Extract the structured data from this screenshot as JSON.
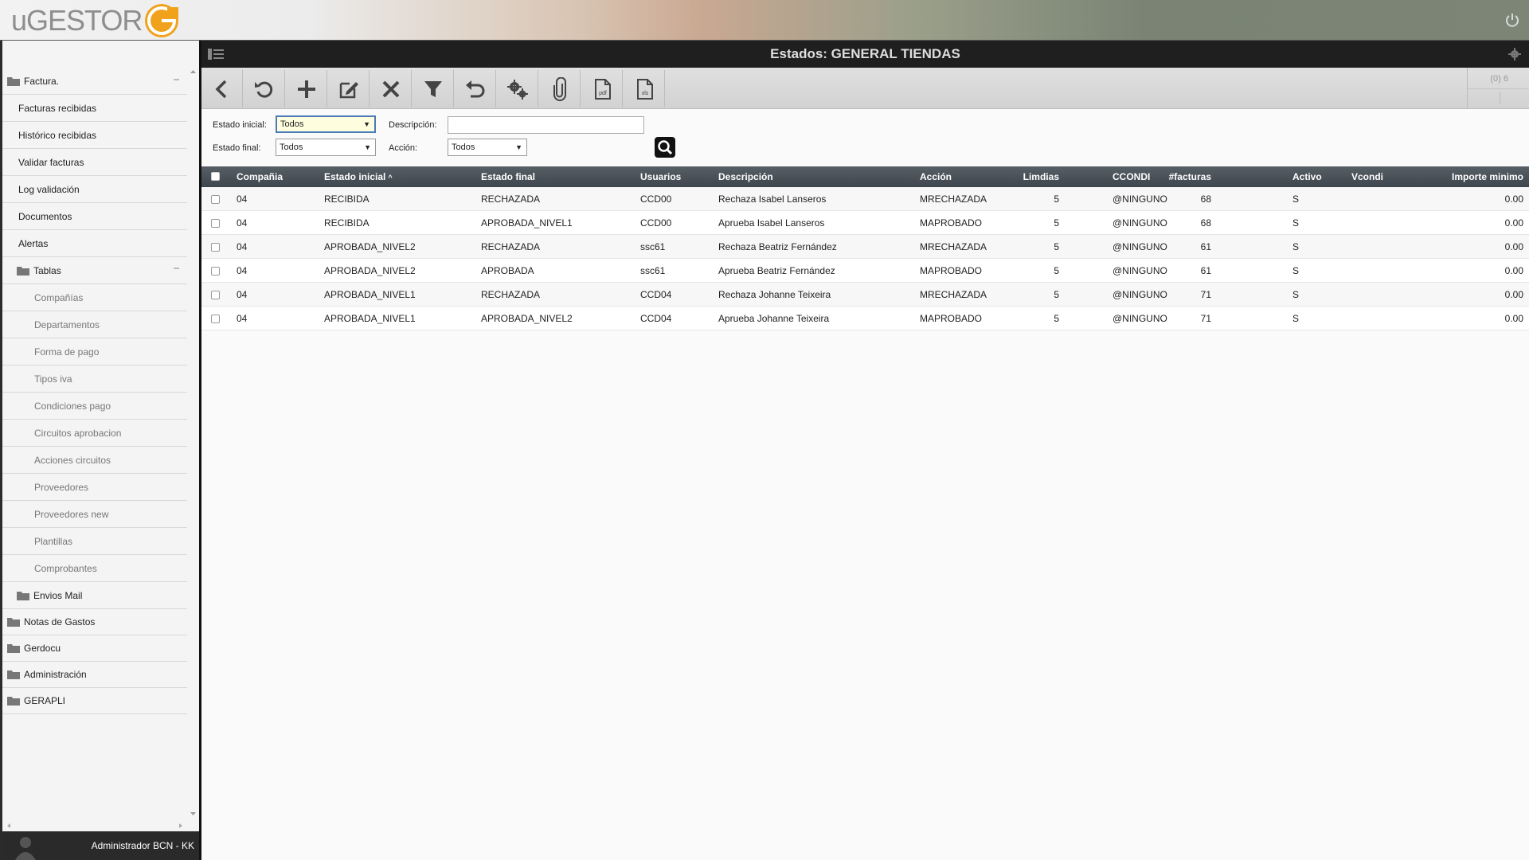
{
  "app": {
    "logo_text": "uGESTOR",
    "accent": "#f0a21c"
  },
  "title_bar": {
    "title": "Estados: GENERAL TIENDAS"
  },
  "toolbar": {
    "buttons": [
      "back-icon",
      "refresh-icon",
      "add-icon",
      "edit-icon",
      "delete-icon",
      "filter-icon",
      "undo-icon",
      "settings-icon",
      "attach-icon",
      "pdf-icon",
      "xls-icon"
    ],
    "pdf_label": "pdf",
    "xls_label": "xls",
    "record_count": "(0) 6"
  },
  "filters": {
    "estado_inicial_label": "Estado inicial:",
    "estado_inicial_value": "Todos",
    "estado_final_label": "Estado final:",
    "estado_final_value": "Todos",
    "descripcion_label": "Descripción:",
    "descripcion_value": "",
    "accion_label": "Acción:",
    "accion_value": "Todos"
  },
  "sidebar": {
    "items": [
      {
        "label": "Factura.",
        "level": 0,
        "folder": true
      },
      {
        "label": "Facturas recibidas",
        "level": 1
      },
      {
        "label": "Histórico recibidas",
        "level": 1
      },
      {
        "label": "Validar facturas",
        "level": 1
      },
      {
        "label": "Log validación",
        "level": 1
      },
      {
        "label": "Documentos",
        "level": 1
      },
      {
        "label": "Alertas",
        "level": 1
      },
      {
        "label": "Tablas",
        "level": 1,
        "folder": true
      },
      {
        "label": "Compañías",
        "level": 2
      },
      {
        "label": "Departamentos",
        "level": 2
      },
      {
        "label": "Forma de pago",
        "level": 2
      },
      {
        "label": "Tipos iva",
        "level": 2
      },
      {
        "label": "Condiciones pago",
        "level": 2
      },
      {
        "label": "Circuitos aprobacion",
        "level": 2
      },
      {
        "label": "Acciones circuitos",
        "level": 2
      },
      {
        "label": "Proveedores",
        "level": 2
      },
      {
        "label": "Proveedores new",
        "level": 2
      },
      {
        "label": "Plantillas",
        "level": 2
      },
      {
        "label": "Comprobantes",
        "level": 2
      },
      {
        "label": "Envios Mail",
        "level": 1,
        "folder": true
      },
      {
        "label": "Notas de Gastos",
        "level": 0,
        "folder": true
      },
      {
        "label": "Gerdocu",
        "level": 0,
        "folder": true
      },
      {
        "label": "Administración",
        "level": 0,
        "folder": true
      },
      {
        "label": "GERAPLI",
        "level": 0,
        "folder": true
      }
    ],
    "user": "Administrador BCN - KK"
  },
  "grid": {
    "columns": [
      "Compañia",
      "Estado inicial",
      "Estado final",
      "Usuarios",
      "Descripción",
      "Acción",
      "Limdias",
      "CCONDI",
      "#facturas",
      "Activo",
      "Vcondi",
      "Importe minimo"
    ],
    "rows": [
      [
        "04",
        "RECIBIDA",
        "RECHAZADA",
        "CCD00",
        "Rechaza Isabel Lanseros",
        "MRECHAZADA",
        "5",
        "@NINGUNO",
        "68",
        "S",
        "",
        "0.00"
      ],
      [
        "04",
        "RECIBIDA",
        "APROBADA_NIVEL1",
        "CCD00",
        "Aprueba Isabel Lanseros",
        "MAPROBADO",
        "5",
        "@NINGUNO",
        "68",
        "S",
        "",
        "0.00"
      ],
      [
        "04",
        "APROBADA_NIVEL2",
        "RECHAZADA",
        "ssc61",
        "Rechaza Beatriz Fernández",
        "MRECHAZADA",
        "5",
        "@NINGUNO",
        "61",
        "S",
        "",
        "0.00"
      ],
      [
        "04",
        "APROBADA_NIVEL2",
        "APROBADA",
        "ssc61",
        "Aprueba Beatriz Fernández",
        "MAPROBADO",
        "5",
        "@NINGUNO",
        "61",
        "S",
        "",
        "0.00"
      ],
      [
        "04",
        "APROBADA_NIVEL1",
        "RECHAZADA",
        "CCD04",
        "Rechaza Johanne Teixeira",
        "MRECHAZADA",
        "5",
        "@NINGUNO",
        "71",
        "S",
        "",
        "0.00"
      ],
      [
        "04",
        "APROBADA_NIVEL1",
        "APROBADA_NIVEL2",
        "CCD04",
        "Aprueba Johanne Teixeira",
        "MAPROBADO",
        "5",
        "@NINGUNO",
        "71",
        "S",
        "",
        "0.00"
      ]
    ]
  }
}
